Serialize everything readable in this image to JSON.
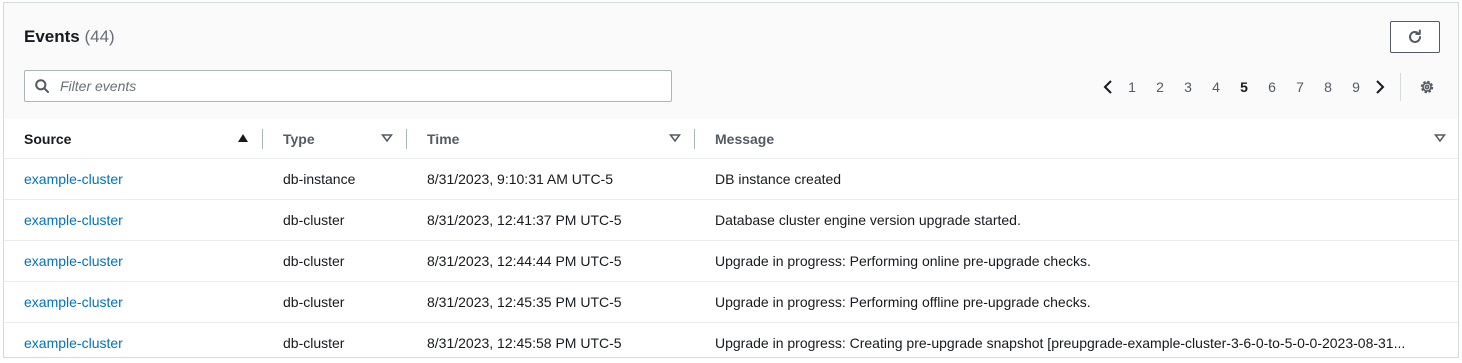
{
  "header": {
    "title": "Events",
    "count": "(44)"
  },
  "filter": {
    "placeholder": "Filter events",
    "value": ""
  },
  "pagination": {
    "pages": [
      "1",
      "2",
      "3",
      "4",
      "5",
      "6",
      "7",
      "8",
      "9"
    ],
    "current": "5"
  },
  "table": {
    "columns": [
      "Source",
      "Type",
      "Time",
      "Message"
    ],
    "rows": [
      {
        "source": "example-cluster",
        "type": "db-instance",
        "time": "8/31/2023, 9:10:31 AM UTC-5",
        "message": "DB instance created"
      },
      {
        "source": "example-cluster",
        "type": "db-cluster",
        "time": "8/31/2023, 12:41:37 PM UTC-5",
        "message": "Database cluster engine version upgrade started."
      },
      {
        "source": "example-cluster",
        "type": "db-cluster",
        "time": "8/31/2023, 12:44:44 PM UTC-5",
        "message": "Upgrade in progress: Performing online pre-upgrade checks."
      },
      {
        "source": "example-cluster",
        "type": "db-cluster",
        "time": "8/31/2023, 12:45:35 PM UTC-5",
        "message": "Upgrade in progress: Performing offline pre-upgrade checks."
      },
      {
        "source": "example-cluster",
        "type": "db-cluster",
        "time": "8/31/2023, 12:45:58 PM UTC-5",
        "message": "Upgrade in progress: Creating pre-upgrade snapshot [preupgrade-example-cluster-3-6-0-to-5-0-0-2023-08-31..."
      }
    ]
  },
  "icons": {
    "refresh": "refresh-icon",
    "search": "search-icon",
    "settings": "gear-icon",
    "prev": "chevron-left-icon",
    "next": "chevron-right-icon"
  },
  "colors": {
    "link": "#0073bb",
    "border": "#d5dbdb",
    "text": "#16191f",
    "muted": "#687078"
  }
}
